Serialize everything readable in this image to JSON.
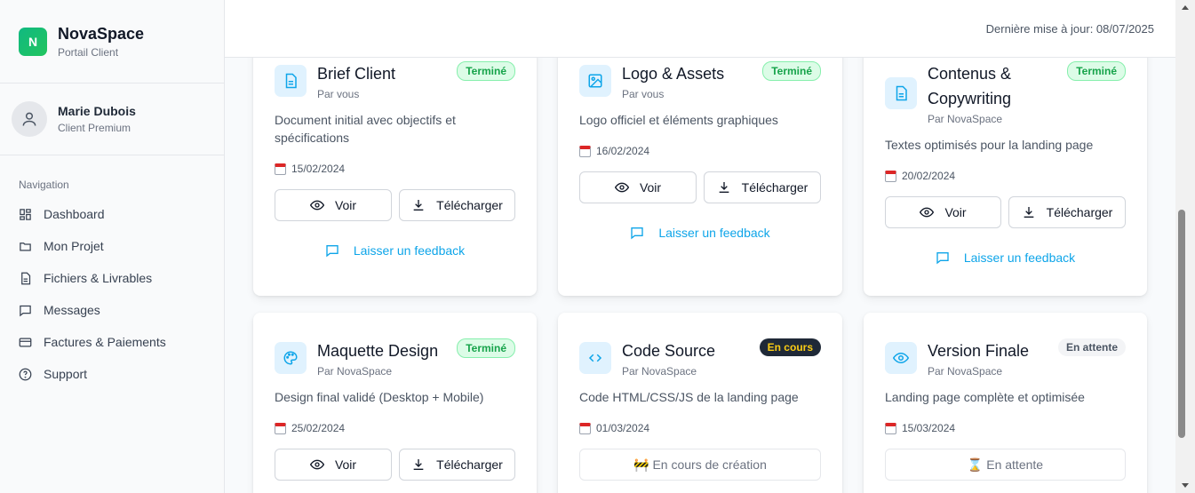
{
  "brand": {
    "logo_letter": "N",
    "name": "NovaSpace",
    "subtitle": "Portail Client"
  },
  "user": {
    "name": "Marie Dubois",
    "role": "Client Premium"
  },
  "nav": {
    "title": "Navigation",
    "items": [
      {
        "label": "Dashboard",
        "icon": "dashboard-icon"
      },
      {
        "label": "Mon Projet",
        "icon": "folder-icon"
      },
      {
        "label": "Fichiers & Livrables",
        "icon": "file-icon"
      },
      {
        "label": "Messages",
        "icon": "message-icon"
      },
      {
        "label": "Factures & Paiements",
        "icon": "credit-card-icon"
      },
      {
        "label": "Support",
        "icon": "help-icon"
      }
    ]
  },
  "header": {
    "last_update": "Dernière mise à jour: 08/07/2025"
  },
  "actions": {
    "view": "Voir",
    "download": "Télécharger",
    "feedback": "Laisser un feedback"
  },
  "cards": [
    {
      "title": "Brief Client",
      "by": "Par vous",
      "status": "Terminé",
      "status_type": "done",
      "description": "Document initial avec objectifs et spécifications",
      "date": "15/02/2024",
      "icon": "document-icon"
    },
    {
      "title": "Logo & Assets",
      "by": "Par vous",
      "status": "Terminé",
      "status_type": "done",
      "description": "Logo officiel et éléments graphiques",
      "date": "16/02/2024",
      "icon": "image-icon"
    },
    {
      "title_line1": "Contenus &",
      "title_line2": "Copywriting",
      "by": "Par NovaSpace",
      "status": "Terminé",
      "status_type": "done",
      "description": "Textes optimisés pour la landing page",
      "date": "20/02/2024",
      "icon": "document-icon"
    },
    {
      "title": "Maquette Design",
      "by": "Par NovaSpace",
      "status": "Terminé",
      "status_type": "done",
      "description": "Design final validé (Desktop + Mobile)",
      "date": "25/02/2024",
      "icon": "palette-icon"
    },
    {
      "title": "Code Source",
      "by": "Par NovaSpace",
      "status": "En cours",
      "status_type": "progress",
      "description": "Code HTML/CSS/JS de la landing page",
      "date": "01/03/2024",
      "icon": "code-icon",
      "pending_label": "🚧 En cours de création"
    },
    {
      "title": "Version Finale",
      "by": "Par NovaSpace",
      "status": "En attente",
      "status_type": "wait",
      "description": "Landing page complète et optimisée",
      "date": "15/03/2024",
      "icon": "eye-icon",
      "pending_label": "⌛ En attente"
    }
  ],
  "colors": {
    "accent": "#0ea5e9",
    "brand_green": "#10b981",
    "done_green": "#16a34a"
  }
}
